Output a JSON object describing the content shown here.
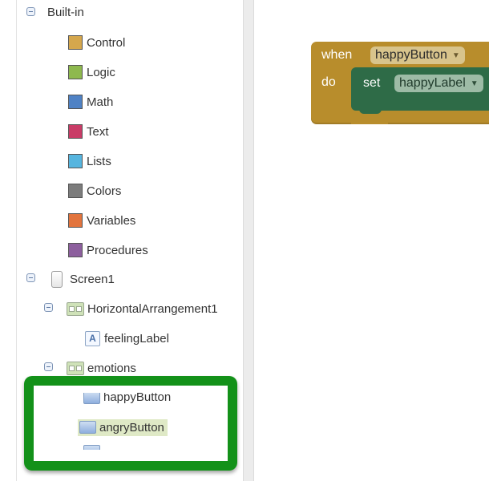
{
  "tree": {
    "builtin": {
      "label": "Built-in",
      "items": [
        {
          "label": "Control",
          "color": "#d5a74d"
        },
        {
          "label": "Logic",
          "color": "#8eb94e"
        },
        {
          "label": "Math",
          "color": "#4f82c5"
        },
        {
          "label": "Text",
          "color": "#c93c67"
        },
        {
          "label": "Lists",
          "color": "#56b5df"
        },
        {
          "label": "Colors",
          "color": "#7c7c7c"
        },
        {
          "label": "Variables",
          "color": "#e2743d"
        },
        {
          "label": "Procedures",
          "color": "#8d5f9e"
        }
      ]
    },
    "screen": {
      "label": "Screen1"
    },
    "arrangement": {
      "label": "HorizontalArrangement1",
      "child": "feelingLabel"
    },
    "emotions": {
      "label": "emotions",
      "children": [
        "happyButton",
        "angryButton"
      ],
      "selected": "angryButton"
    }
  },
  "block": {
    "when_label": "when",
    "component": "happyButton",
    "do_label": "do",
    "set_label": "set",
    "target": "happyLabel"
  },
  "colors": {
    "highlight": "#139119",
    "event_block": "#b88d2c",
    "set_block": "#2e6b47"
  }
}
